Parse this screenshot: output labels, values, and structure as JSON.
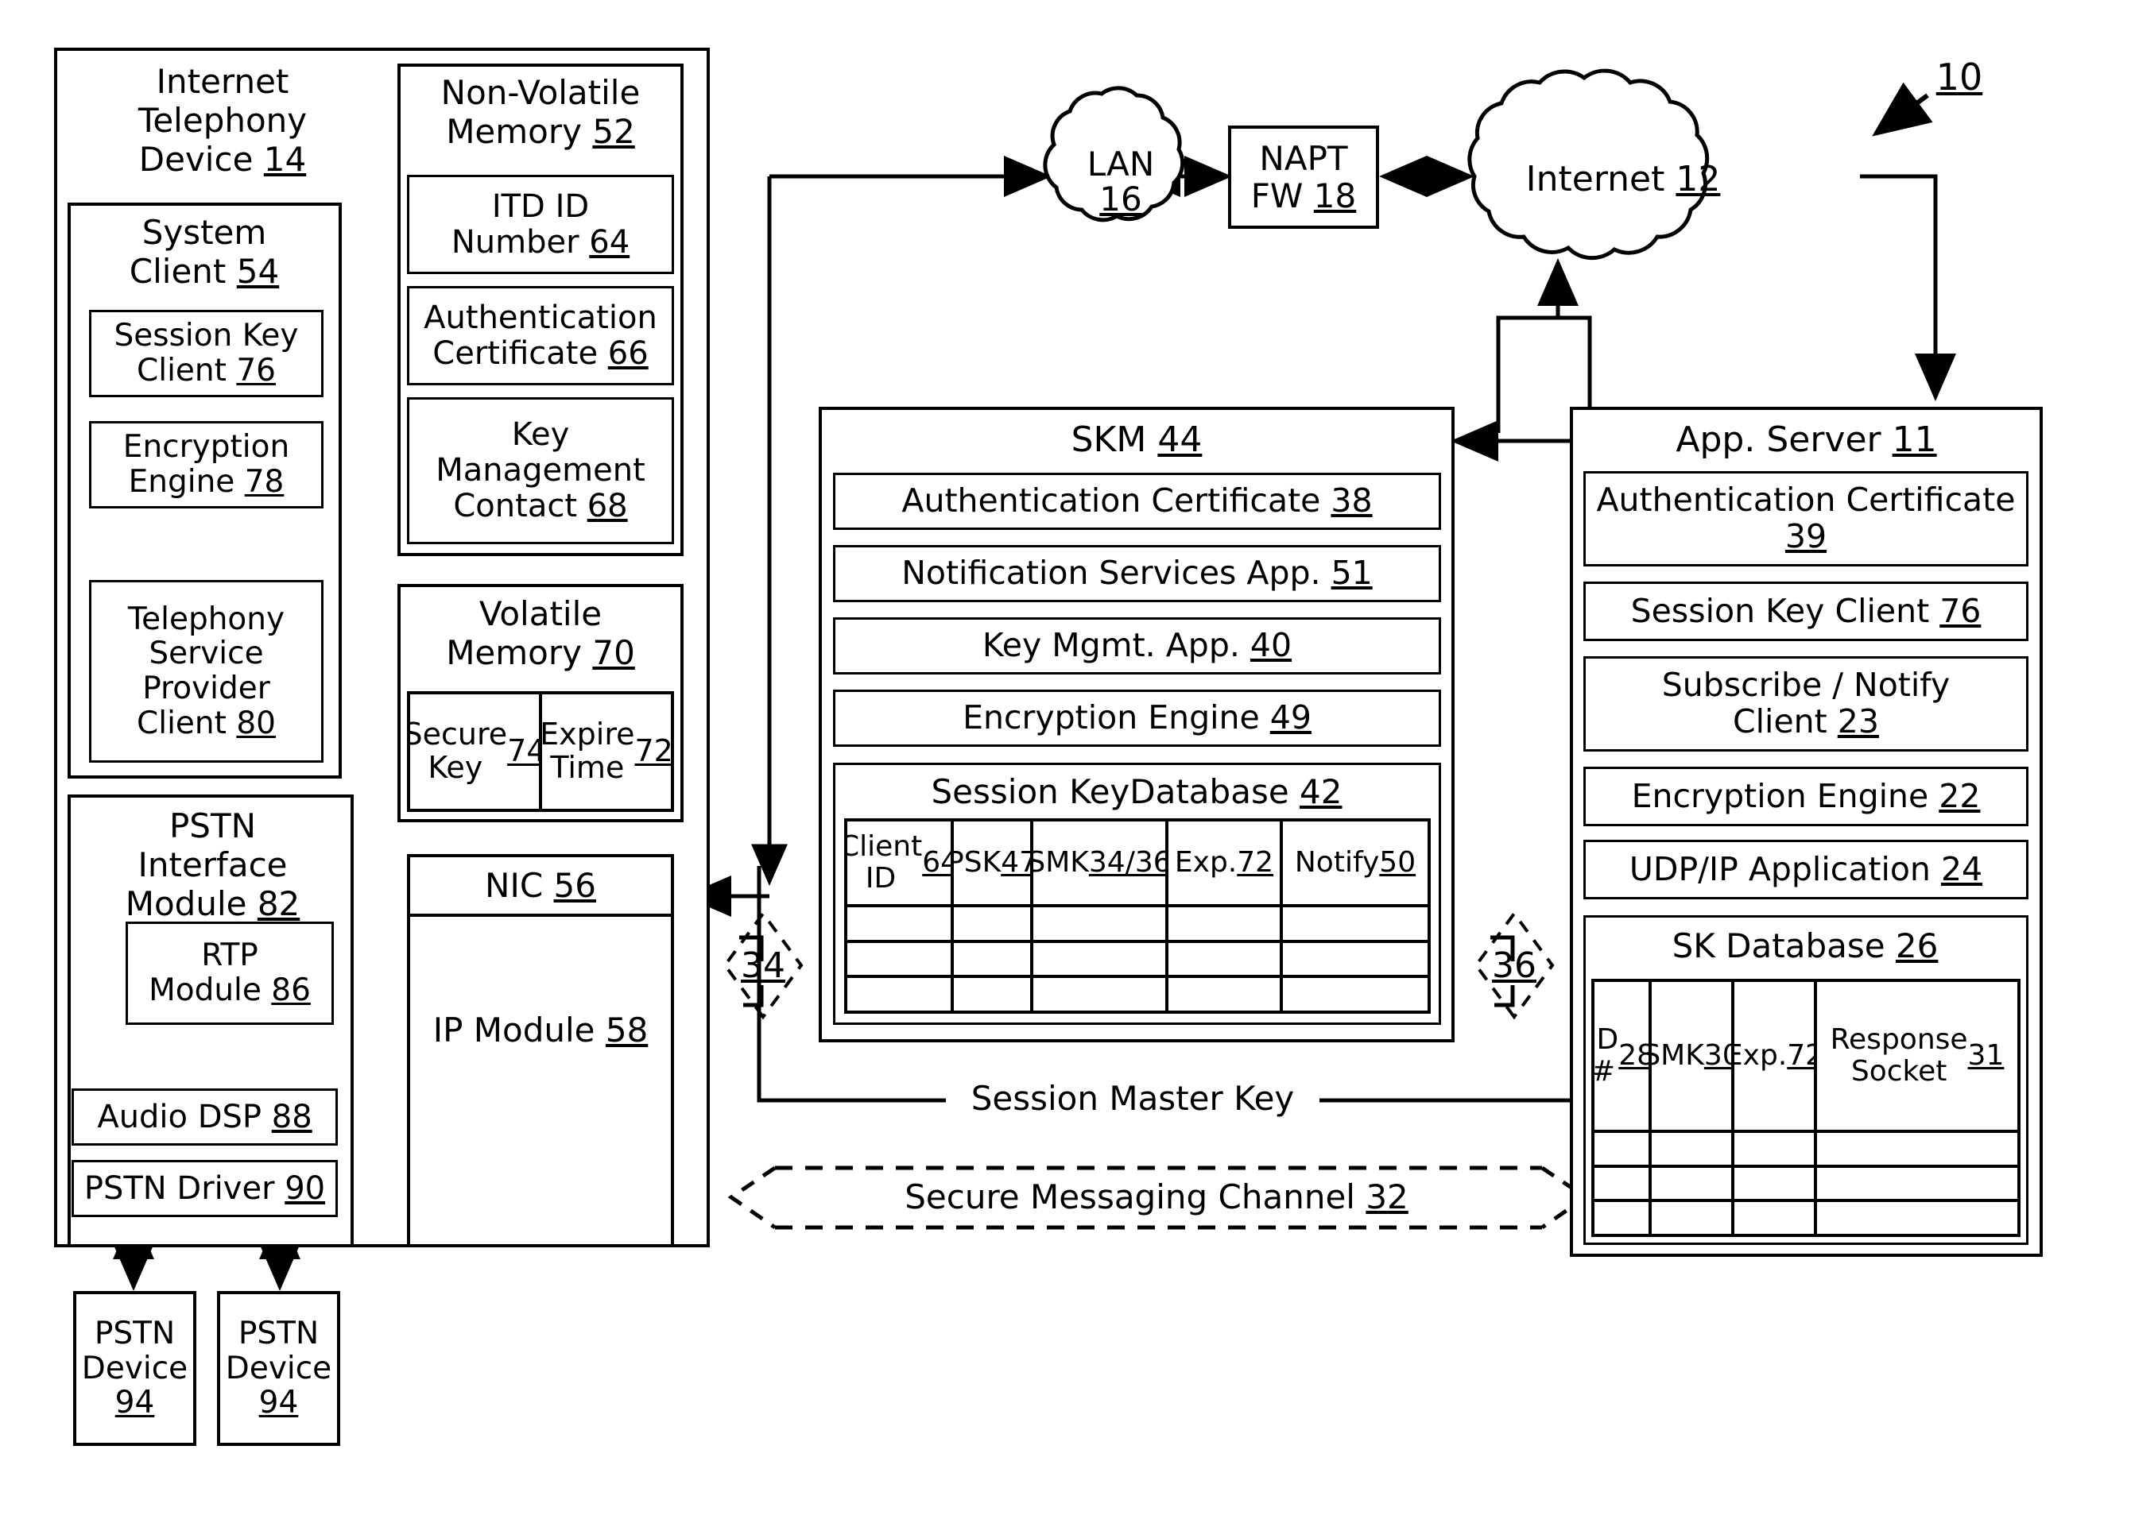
{
  "figure": {
    "ref_label": "10"
  },
  "itd": {
    "title": "Internet\nTelephony\nDevice 14",
    "title_num": "14",
    "system_client": {
      "title": "System\nClient 54",
      "items": [
        {
          "label": "Session Key\nClient 76"
        },
        {
          "label": "Encryption\nEngine 78"
        },
        {
          "label": "Telephony\nService\nProvider\nClient 80"
        }
      ]
    },
    "pstn_interface": {
      "title": "PSTN\nInterface\nModule 82",
      "rtp": "RTP\nModule 86",
      "audio_dsp": "Audio DSP 88",
      "pstn_driver": "PSTN Driver 90"
    },
    "non_volatile_memory": {
      "title": "Non-Volatile\nMemory 52",
      "items": [
        {
          "label": "ITD ID\nNumber 64"
        },
        {
          "label": "Authentication\nCertificate 66"
        },
        {
          "label": "Key\nManagement\nContact 68"
        }
      ]
    },
    "volatile_memory": {
      "title": "Volatile\nMemory 70",
      "cells": [
        {
          "label": "Secure\nKey\n74"
        },
        {
          "label": "Expire\nTime\n72"
        }
      ]
    },
    "nic": {
      "title": "NIC 56",
      "ip_module": "IP Module 58"
    }
  },
  "pstn_devices": [
    {
      "label": "PSTN\nDevice\n94"
    },
    {
      "label": "PSTN\nDevice\n94"
    }
  ],
  "network": {
    "lan": "LAN\n16",
    "napt_fw": "NAPT\nFW 18",
    "internet": "Internet 12"
  },
  "skm": {
    "title": "SKM 44",
    "items": [
      {
        "label": "Authentication Certificate 38"
      },
      {
        "label": "Notification Services App. 51"
      },
      {
        "label": "Key Mgmt. App. 40"
      },
      {
        "label": "Encryption Engine 49"
      }
    ],
    "database": {
      "title": "Session KeyDatabase 42",
      "columns": [
        "Client\nID 64",
        "PSK\n47",
        "SMK\n34/36",
        "Exp.\n72",
        "Notify\n50"
      ],
      "empty_rows": 3
    }
  },
  "app_server": {
    "title": "App. Server 11",
    "items": [
      {
        "label": "Authentication Certificate\n39"
      },
      {
        "label": "Session Key Client 76"
      },
      {
        "label": "Subscribe / Notify\nClient 23"
      },
      {
        "label": "Encryption Engine 22"
      },
      {
        "label": "UDP/IP Application 24"
      }
    ],
    "database": {
      "title": "SK Database 26",
      "columns": [
        "ID\n#\n28",
        "SMK\n30",
        "Exp.\n72",
        "Response\nSocket 31"
      ],
      "empty_rows": 3
    }
  },
  "connectors": {
    "smk_left_ref": "34",
    "smk_right_ref": "36",
    "session_master_key": "Session Master Key",
    "secure_messaging_channel": "Secure Messaging Channel 32"
  }
}
